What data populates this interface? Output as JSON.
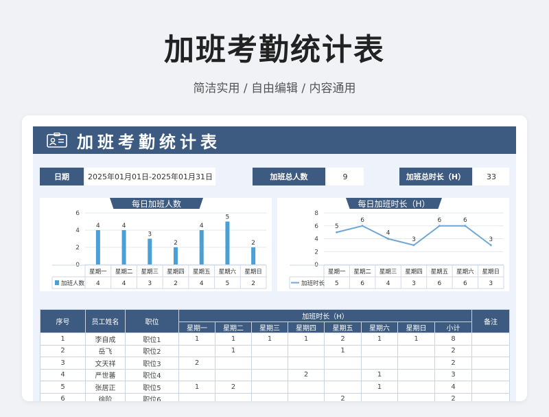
{
  "page": {
    "title": "加班考勤统计表",
    "subtitle": "简洁实用 / 自由编辑 / 内容通用"
  },
  "sheet": {
    "banner_title": "加班考勤统计表",
    "date_label": "日期",
    "date_value": "2025年01月01日-2025年01月31日",
    "total_people_label": "加班总人数",
    "total_people_value": "9",
    "total_hours_label": "加班总时长（H）",
    "total_hours_value": "33"
  },
  "colors": {
    "primary": "#3d5a80",
    "bar": "#4a9fd4",
    "line": "#6fa6d6"
  },
  "chart_data": [
    {
      "type": "bar",
      "title": "每日加班人数",
      "categories": [
        "星期一",
        "星期二",
        "星期三",
        "星期四",
        "星期五",
        "星期六",
        "星期日"
      ],
      "series": [
        {
          "name": "加班人数",
          "values": [
            4,
            4,
            3,
            2,
            4,
            5,
            2
          ]
        }
      ],
      "ylim": [
        0,
        6
      ],
      "yticks": [
        "0",
        "2",
        "4",
        "6"
      ],
      "grid": true,
      "legend": "bottom-left-table"
    },
    {
      "type": "line",
      "title": "每日加班时长（H）",
      "categories": [
        "星期一",
        "星期二",
        "星期三",
        "星期四",
        "星期五",
        "星期六",
        "星期日"
      ],
      "series": [
        {
          "name": "加班时长",
          "values": [
            5,
            6,
            4,
            3,
            6,
            6,
            3
          ]
        }
      ],
      "ylim": [
        0,
        8
      ],
      "yticks": [
        "0",
        "2",
        "4",
        "6",
        "8"
      ],
      "grid": true,
      "legend": "bottom-left-table"
    }
  ],
  "table": {
    "headers": {
      "no": "序号",
      "name": "员工姓名",
      "position": "职位",
      "hours": "加班时长（H）",
      "remark": "备注",
      "days": [
        "星期一",
        "星期二",
        "星期三",
        "星期四",
        "星期五",
        "星期六",
        "星期日"
      ],
      "subtotal": "小计"
    },
    "rows": [
      {
        "no": "1",
        "name": "李自成",
        "position": "职位1",
        "days": [
          "1",
          "1",
          "1",
          "1",
          "2",
          "1",
          "1"
        ],
        "subtotal": "8",
        "remark": ""
      },
      {
        "no": "2",
        "name": "岳飞",
        "position": "职位2",
        "days": [
          "",
          "1",
          "",
          "",
          "1",
          "",
          ""
        ],
        "subtotal": "2",
        "remark": ""
      },
      {
        "no": "3",
        "name": "文天祥",
        "position": "职位3",
        "days": [
          "2",
          "",
          "",
          "",
          "",
          "",
          ""
        ],
        "subtotal": "2",
        "remark": ""
      },
      {
        "no": "4",
        "name": "严世蕃",
        "position": "职位4",
        "days": [
          "",
          "",
          "",
          "2",
          "",
          "1",
          ""
        ],
        "subtotal": "3",
        "remark": ""
      },
      {
        "no": "5",
        "name": "张居正",
        "position": "职位5",
        "days": [
          "1",
          "2",
          "",
          "",
          "",
          "1",
          ""
        ],
        "subtotal": "4",
        "remark": ""
      },
      {
        "no": "6",
        "name": "徐阶",
        "position": "职位6",
        "days": [
          "",
          "",
          "",
          "",
          "2",
          "",
          ""
        ],
        "subtotal": "2",
        "remark": ""
      }
    ]
  }
}
